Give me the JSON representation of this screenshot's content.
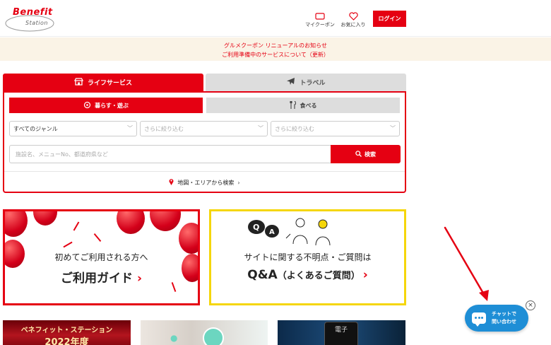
{
  "header": {
    "logo_line1": "Benefit",
    "logo_line2": "Station",
    "coupon_label": "マイクーポン",
    "favorites_label": "お気に入り",
    "login_label": "ログイン",
    "icons": {
      "coupon": "ticket-icon",
      "favorites": "heart-icon"
    }
  },
  "notice": {
    "items": [
      "グルメクーポン リニューアルのお知らせ",
      "ご利用準備中のサービスについて（更新）"
    ]
  },
  "search": {
    "tabs": [
      {
        "label": "ライフサービス",
        "icon": "shop-icon",
        "active": true
      },
      {
        "label": "トラベル",
        "icon": "airplane-icon",
        "active": false
      }
    ],
    "subtabs": [
      {
        "label": "暮らす・遊ぶ",
        "icon": "sparkle-icon",
        "active": true
      },
      {
        "label": "食べる",
        "icon": "cutlery-icon",
        "active": false
      }
    ],
    "genre_select": "すべてのジャンル",
    "narrow1": "さらに絞り込む",
    "narrow2": "さらに絞り込む",
    "keyword_placeholder": "施設名、メニューNo、都道府県など",
    "search_button": "検索",
    "map_link": "地図・エリアから検索"
  },
  "banners": {
    "guide": {
      "line1": "初めてご利用される方へ",
      "line2": "ご利用ガイド"
    },
    "qa": {
      "line1": "サイトに関する不明点・ご質問は",
      "line2_main": "Q&A",
      "line2_sub": "（よくあるご質問）"
    }
  },
  "thumbs": {
    "t1_line1": "ベネフィット・ステーション",
    "t1_line2": "2022年度",
    "t3_label": "電子"
  },
  "chat": {
    "line1": "チャットで",
    "line2": "問い合わせ",
    "close": "×"
  },
  "colors": {
    "brand": "#e50012",
    "chat": "#1e8ed6",
    "qa_border": "#f5d60a",
    "notice_bg": "#faf3e6"
  }
}
